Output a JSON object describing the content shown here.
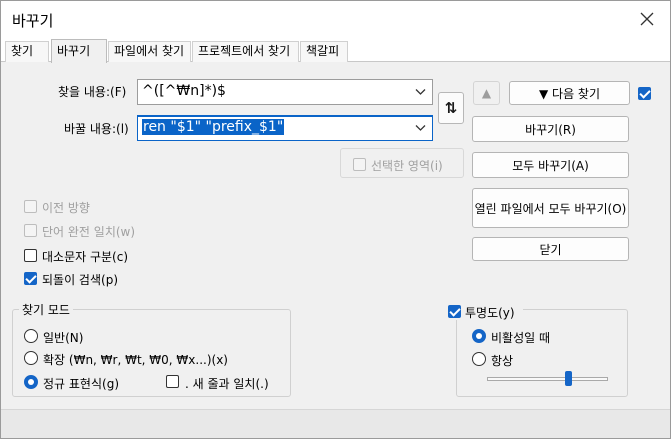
{
  "window": {
    "title": "바꾸기"
  },
  "tabs": [
    {
      "label": "찾기"
    },
    {
      "label": "바꾸기"
    },
    {
      "label": "파일에서 찾기"
    },
    {
      "label": "프로젝트에서 찾기"
    },
    {
      "label": "책갈피"
    }
  ],
  "find": {
    "label": "찾을 내용:(F)",
    "value": "^([^₩n]*)$"
  },
  "replace": {
    "label": "바꿀 내용:(l)",
    "value": "ren \"$1\" \"prefix_$1\""
  },
  "buttons": {
    "swap_glyph": "⇅",
    "up_glyph": "▲",
    "find_next": "▼ 다음 찾기",
    "replace": "바꾸기(R)",
    "replace_all": "모두 바꾸기(A)",
    "replace_all_open": "열린 파일에서 모두 바꾸기(O)",
    "close": "닫기"
  },
  "options": {
    "in_selection": {
      "label": "선택한 영역(i)",
      "checked": false,
      "enabled": false
    },
    "backward": {
      "label": "이전 방향",
      "checked": false,
      "enabled": false
    },
    "whole_word": {
      "label": "단어 완전 일치(w)",
      "checked": false,
      "enabled": false
    },
    "match_case": {
      "label": "대소문자 구분(c)",
      "checked": false,
      "enabled": true
    },
    "wrap": {
      "label": "되돌이 검색(p)",
      "checked": true,
      "enabled": true
    },
    "find_next_check": {
      "checked": true
    }
  },
  "search_mode": {
    "title": "찾기 모드",
    "normal": "일반(N)",
    "extended": "확장 (₩n, ₩r, ₩t, ₩0, ₩x...)(x)",
    "regex": "정규 표현식(g)",
    "selected": "regex",
    "dot_newline": ". 새 줄과 일치(.)"
  },
  "transparency": {
    "label": "투명도(y)",
    "checked": true,
    "on_lose_focus": "비활성일 때",
    "always": "항상",
    "selected": "on_lose_focus",
    "level": 0.65
  },
  "colors": {
    "accent": "#1465c7"
  }
}
